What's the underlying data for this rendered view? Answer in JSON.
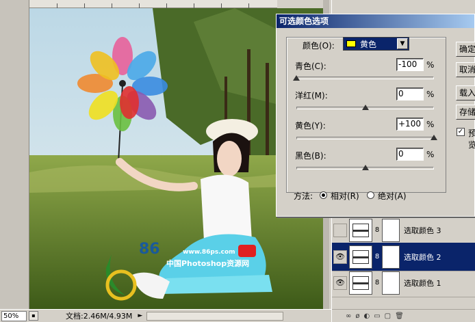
{
  "workspace": {
    "zoom": "50%",
    "doc_info": "文档:2.46M/4.93M",
    "status_arrow": "►",
    "watermark_site": "www.86ps.com",
    "watermark_cn": "中国Photoshop资源网",
    "watermark_num": "86"
  },
  "dialog": {
    "title": "可选颜色选项",
    "color_label": "颜色(O):",
    "color_value": "黄色",
    "sliders": [
      {
        "label": "青色(C):",
        "value": "-100",
        "pct": "%",
        "level": -100
      },
      {
        "label": "洋红(M):",
        "value": "0",
        "pct": "%",
        "level": 0
      },
      {
        "label": "黄色(Y):",
        "value": "+100",
        "pct": "%",
        "level": 100
      },
      {
        "label": "黑色(B):",
        "value": "0",
        "pct": "%",
        "level": 0
      }
    ],
    "method_label": "方法:",
    "method_relative": "相对(R)",
    "method_absolute": "绝对(A)",
    "buttons": {
      "ok": "确定",
      "cancel": "取消",
      "load": "载入...",
      "save": "存储..."
    },
    "preview_label": "预览",
    "preview_check": "✓"
  },
  "layers": {
    "items": [
      {
        "name": "选取颜色 3",
        "eye": "",
        "selected": false
      },
      {
        "name": "选取颜色 2",
        "eye": "👁",
        "selected": true
      },
      {
        "name": "选取颜色 1",
        "eye": "👁",
        "selected": false
      }
    ],
    "chain": "8",
    "bottom_icons": [
      "∞",
      "ø",
      "◐",
      "▭",
      "▢",
      "🗑"
    ]
  },
  "colors": {
    "titlebar": "#0a246a",
    "selection": "#0a246a",
    "swatch": "#ffff00"
  }
}
